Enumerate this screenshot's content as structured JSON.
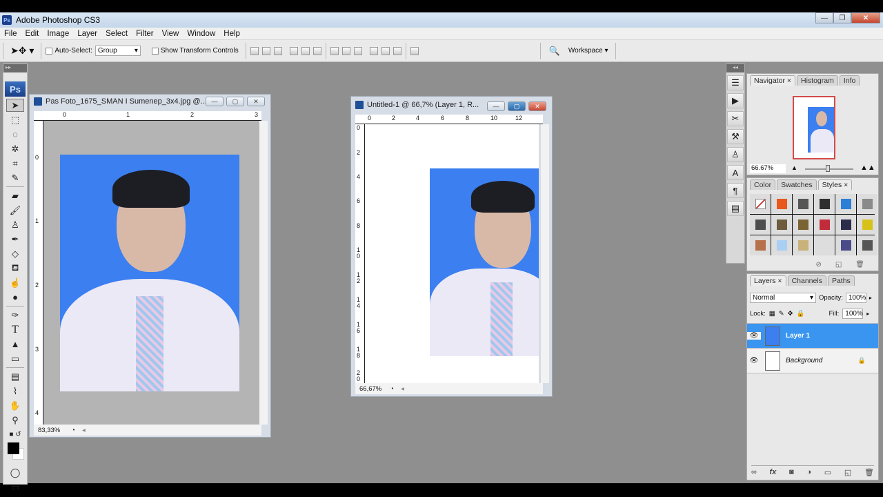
{
  "app": {
    "title": "Adobe Photoshop CS3",
    "icon": "Ps"
  },
  "menu": [
    "File",
    "Edit",
    "Image",
    "Layer",
    "Select",
    "Filter",
    "View",
    "Window",
    "Help"
  ],
  "options": {
    "auto_select_label": "Auto-Select:",
    "auto_select_value": "Group",
    "transform_label": "Show Transform Controls",
    "workspace_label": "Workspace ▾"
  },
  "toolbox": {
    "logo": "Ps",
    "tools": [
      "move",
      "marquee",
      "lasso",
      "magic-wand",
      "crop",
      "slice",
      "healing",
      "brush",
      "stamp",
      "history-brush",
      "eraser",
      "paint-bucket",
      "blur",
      "dodge",
      "pen",
      "type",
      "path-select",
      "shape",
      "notes",
      "eyedropper",
      "hand",
      "zoom"
    ]
  },
  "doc1": {
    "title": "Pas Foto_1675_SMAN I Sumenep_3x4.jpg @...",
    "zoom": "83,33%",
    "h_ruler": [
      "0",
      "1",
      "2",
      "3"
    ],
    "v_ruler": [
      "0",
      "1",
      "2",
      "3",
      "4"
    ]
  },
  "doc2": {
    "title": "Untitled-1 @ 66,7% (Layer 1, R...",
    "zoom": "66,67%",
    "h_ruler": [
      "0",
      "2",
      "4",
      "6",
      "8",
      "10",
      "12"
    ],
    "v_ruler": [
      "0",
      "2",
      "4",
      "6",
      "8",
      "10",
      "12",
      "14",
      "16",
      "18",
      "20"
    ]
  },
  "navigator": {
    "tabs": [
      "Navigator ×",
      "Histogram",
      "Info"
    ],
    "zoom": "66.67%"
  },
  "styles": {
    "tabs": [
      "Color",
      "Swatches",
      "Styles ×"
    ],
    "swatches": [
      "#ffffff",
      "#e8571c",
      "#555555",
      "#2f2f2f",
      "#2c7fd6",
      "#8a8a8a",
      "#4e4e4e",
      "#6d5d3d",
      "#7a6332",
      "#c22b3a",
      "#2b2b4a",
      "#d7c21a",
      "#b7714a",
      "#a9d0f2",
      "#c9b27a",
      "#dddddd",
      "#4a4a8a",
      "#555555"
    ]
  },
  "layers": {
    "tabs": [
      "Layers ×",
      "Channels",
      "Paths"
    ],
    "blend_mode": "Normal",
    "opacity_label": "Opacity:",
    "opacity": "100%",
    "lock_label": "Lock:",
    "fill_label": "Fill:",
    "fill": "100%",
    "items": [
      {
        "name": "Layer 1",
        "selected": true
      },
      {
        "name": "Background",
        "locked": true
      }
    ]
  }
}
